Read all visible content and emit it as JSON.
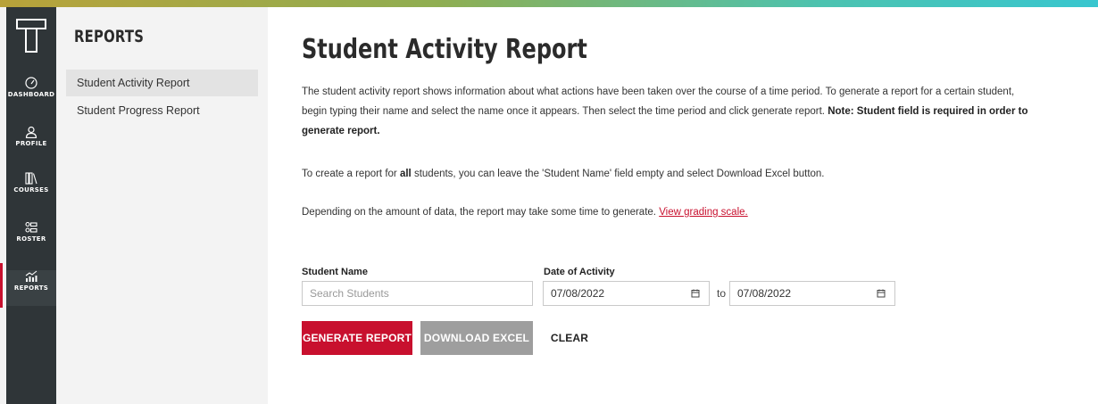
{
  "colors": {
    "accent": "#c8102e",
    "rail": "#2f3538",
    "secondary_button": "#9e9e9e"
  },
  "rail": {
    "items": [
      {
        "icon": "dashboard-icon",
        "label": "DASHBOARD"
      },
      {
        "icon": "profile-icon",
        "label": "PROFILE"
      },
      {
        "icon": "courses-icon",
        "label": "COURSES"
      },
      {
        "icon": "roster-icon",
        "label": "ROSTER"
      },
      {
        "icon": "reports-icon",
        "label": "REPORTS"
      }
    ]
  },
  "subnav": {
    "title": "REPORTS",
    "items": [
      {
        "label": "Student Activity Report"
      },
      {
        "label": "Student Progress Report"
      }
    ]
  },
  "main": {
    "title": "Student Activity Report",
    "intro_text": "The student activity report shows information about what actions have been taken over the course of a time period. To generate a report for a certain student, begin typing their name and select the name once it appears. Then select the time period and click generate report.",
    "intro_note": "Note: Student field is required in order to generate report.",
    "all_students_prefix": "To create a report for",
    "all_students_bold": "all",
    "all_students_suffix": "students, you can leave the 'Student Name' field empty and select Download Excel button.",
    "data_note": "Depending on the amount of data, the report may take some time to generate.",
    "grading_link": "View grading scale."
  },
  "form": {
    "student_label": "Student Name",
    "student_placeholder": "Search Students",
    "student_value": "",
    "date_label": "Date of Activity",
    "date_from": "07/08/2022",
    "to_label": "to",
    "date_to": "07/08/2022"
  },
  "buttons": {
    "generate": "GENERATE REPORT",
    "download": "DOWNLOAD EXCEL",
    "clear": "CLEAR"
  }
}
